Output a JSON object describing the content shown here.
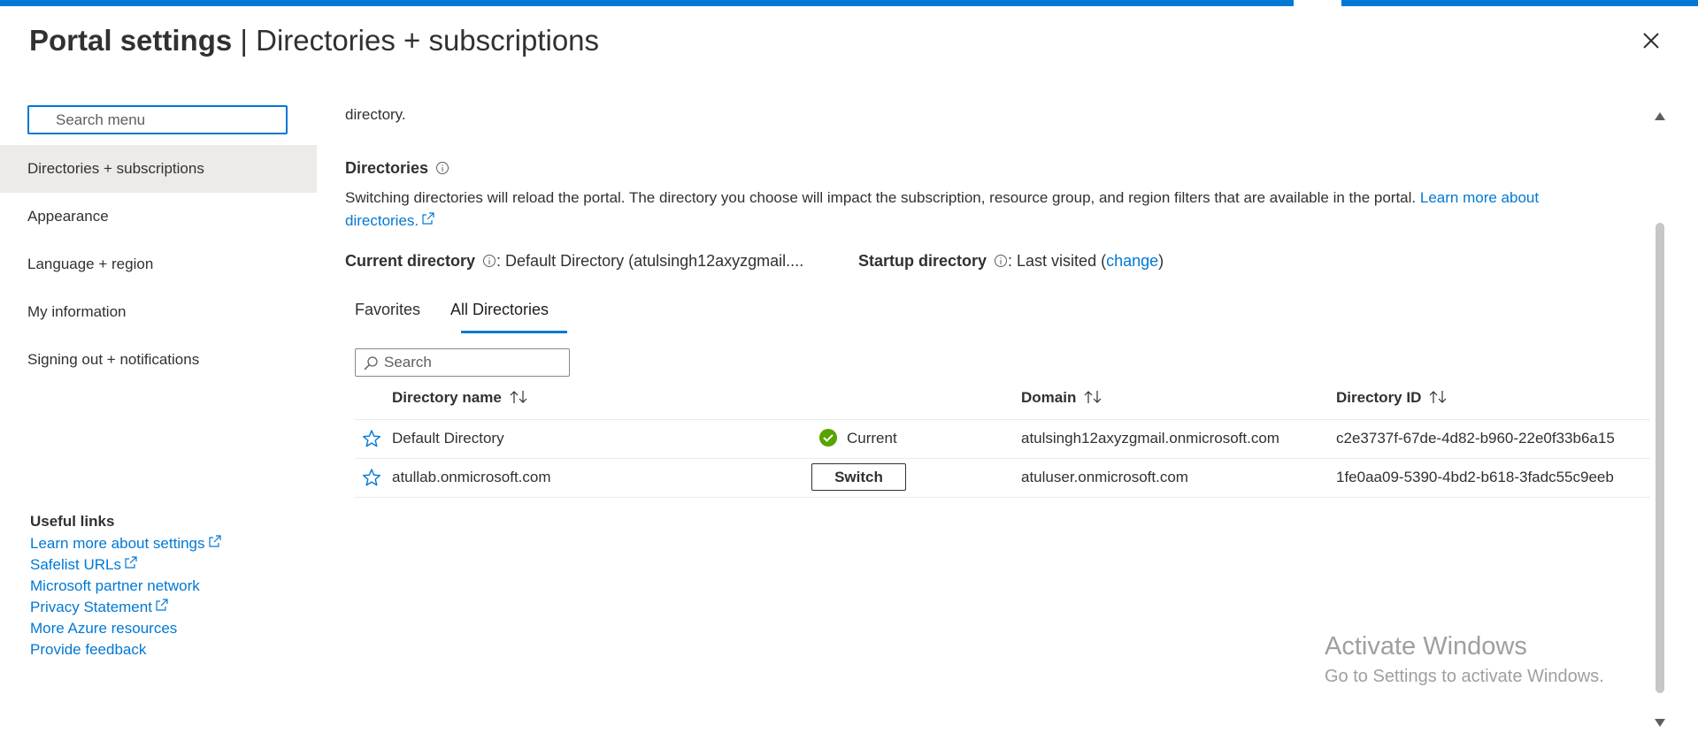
{
  "header": {
    "title_strong": "Portal settings",
    "title_separator": " | ",
    "title_rest": "Directories + subscriptions"
  },
  "sidebar": {
    "search_placeholder": "Search menu",
    "items": [
      {
        "label": "Directories + subscriptions",
        "active": true
      },
      {
        "label": "Appearance",
        "active": false
      },
      {
        "label": "Language + region",
        "active": false
      },
      {
        "label": "My information",
        "active": false
      },
      {
        "label": "Signing out + notifications",
        "active": false
      }
    ],
    "useful_links": {
      "title": "Useful links",
      "items": [
        {
          "label": "Learn more about settings",
          "external": true
        },
        {
          "label": "Safelist URLs",
          "external": true
        },
        {
          "label": "Microsoft partner network",
          "external": false
        },
        {
          "label": "Privacy Statement",
          "external": true
        },
        {
          "label": "More Azure resources",
          "external": false
        },
        {
          "label": "Provide feedback",
          "external": false
        }
      ]
    }
  },
  "main": {
    "lead_text": "directory.",
    "section_title": "Directories",
    "description": "Switching directories will reload the portal. The directory you choose will impact the subscription, resource group, and region filters that are available in the portal. ",
    "description_link": "Learn more about directories.",
    "current_directory": {
      "label": "Current directory",
      "value": ": Default Directory (atulsingh12axyzgmail...."
    },
    "startup_directory": {
      "label": "Startup directory",
      "value_prefix": ": Last visited (",
      "link": "change",
      "value_suffix": ")"
    },
    "tabs": [
      {
        "label": "Favorites",
        "active": false
      },
      {
        "label": "All Directories",
        "active": true
      }
    ],
    "search_placeholder": "Search",
    "table": {
      "columns": [
        "Directory name",
        "Domain",
        "Directory ID"
      ],
      "rows": [
        {
          "name": "Default Directory",
          "status": "Current",
          "action": "",
          "domain": "atulsingh12axyzgmail.onmicrosoft.com",
          "id": "c2e3737f-67de-4d82-b960-22e0f33b6a15"
        },
        {
          "name": "atullab.onmicrosoft.com",
          "status": "",
          "action": "Switch",
          "domain": "atuluser.onmicrosoft.com",
          "id": "1fe0aa09-5390-4bd2-b618-3fadc55c9eeb"
        }
      ]
    }
  },
  "watermark": {
    "line1": "Activate Windows",
    "line2": "Go to Settings to activate Windows."
  },
  "colors": {
    "accent": "#0078d4",
    "active_nav_bg": "#edebe9",
    "success": "#57a300"
  },
  "icons": [
    "close-icon",
    "info-icon",
    "external-link-icon",
    "search-icon",
    "sort-icon",
    "star-icon",
    "check-circle-icon",
    "chevron-up-icon",
    "chevron-down-icon"
  ]
}
